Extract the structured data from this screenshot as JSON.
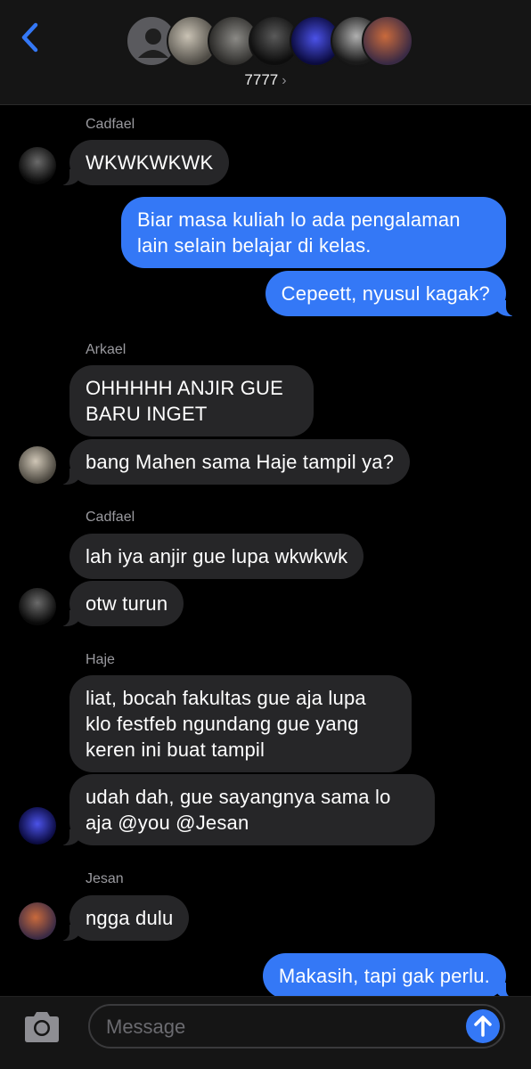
{
  "header": {
    "group_name": "7777",
    "chevron": "›",
    "back_icon": "chevron-left-icon"
  },
  "messages": [
    {
      "sender": "Cadfael",
      "text": "WKWKWKWK"
    },
    {
      "text_out": "Biar masa kuliah lo ada pengalaman lain selain belajar di kelas."
    },
    {
      "text_out": "Cepeett, nyusul kagak?"
    },
    {
      "sender": "Arkael",
      "text": "OHHHHH ANJIR GUE BARU INGET"
    },
    {
      "text": "bang Mahen sama Haje tampil ya?"
    },
    {
      "sender": "Cadfael",
      "text": "lah iya anjir gue lupa wkwkwk"
    },
    {
      "text": "otw turun"
    },
    {
      "sender": "Haje",
      "text": "liat, bocah fakultas gue aja lupa klo festfeb ngundang gue yang keren ini buat tampil"
    },
    {
      "text": "udah dah, gue sayangnya sama lo aja @you @Jesan"
    },
    {
      "sender": "Jesan",
      "text": "ngga dulu"
    },
    {
      "text_out": "Makasih, tapi gak perlu."
    }
  ],
  "composer": {
    "placeholder": "Message",
    "camera_icon": "camera-icon",
    "send_icon": "arrow-up-icon"
  },
  "colors": {
    "outgoing": "#3478f6",
    "incoming": "#262628",
    "background": "#000000",
    "bar": "#151515"
  }
}
